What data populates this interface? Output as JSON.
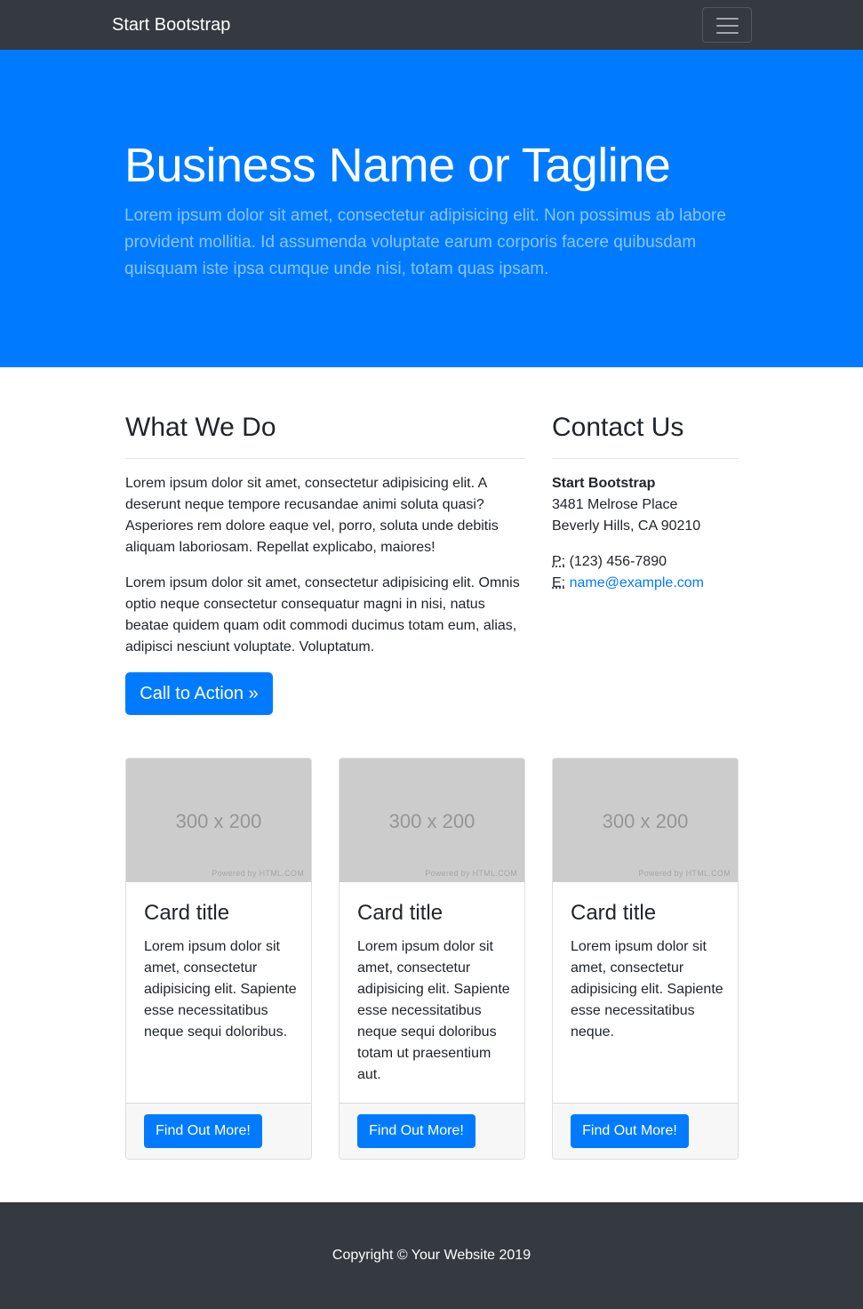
{
  "navbar": {
    "brand": "Start Bootstrap",
    "toggler_icon": "hamburger-menu-icon"
  },
  "hero": {
    "title": "Business Name or Tagline",
    "lead": "Lorem ipsum dolor sit amet, consectetur adipisicing elit. Non possimus ab labore provident mollitia. Id assumenda voluptate earum corporis facere quibusdam quisquam iste ipsa cumque unde nisi, totam quas ipsam."
  },
  "what_we_do": {
    "heading": "What We Do",
    "paragraphs": [
      "Lorem ipsum dolor sit amet, consectetur adipisicing elit. A deserunt neque tempore recusandae animi soluta quasi? Asperiores rem dolore eaque vel, porro, soluta unde debitis aliquam laboriosam. Repellat explicabo, maiores!",
      "Lorem ipsum dolor sit amet, consectetur adipisicing elit. Omnis optio neque consectetur consequatur magni in nisi, natus beatae quidem quam odit commodi ducimus totam eum, alias, adipisci nesciunt voluptate. Voluptatum."
    ],
    "cta_label": "Call to Action »"
  },
  "contact": {
    "heading": "Contact Us",
    "company": "Start Bootstrap",
    "address_line1": "3481 Melrose Place",
    "address_line2": "Beverly Hills, CA 90210",
    "phone_abbr": "P:",
    "phone": "(123) 456-7890",
    "email_abbr": "E:",
    "email": "name@example.com"
  },
  "cards": [
    {
      "image_size": "300 x 200",
      "image_credit": "Powered by HTML.COM",
      "title": "Card title",
      "text": "Lorem ipsum dolor sit amet, consectetur adipisicing elit. Sapiente esse necessitatibus neque sequi doloribus.",
      "button": "Find Out More!"
    },
    {
      "image_size": "300 x 200",
      "image_credit": "Powered by HTML.COM",
      "title": "Card title",
      "text": "Lorem ipsum dolor sit amet, consectetur adipisicing elit. Sapiente esse necessitatibus neque sequi doloribus totam ut praesentium aut.",
      "button": "Find Out More!"
    },
    {
      "image_size": "300 x 200",
      "image_credit": "Powered by HTML.COM",
      "title": "Card title",
      "text": "Lorem ipsum dolor sit amet, consectetur adipisicing elit. Sapiente esse necessitatibus neque.",
      "button": "Find Out More!"
    }
  ],
  "footer": {
    "copyright": "Copyright © Your Website 2019"
  },
  "colors": {
    "primary": "#007bff",
    "dark": "#343a40",
    "text": "#212529"
  }
}
